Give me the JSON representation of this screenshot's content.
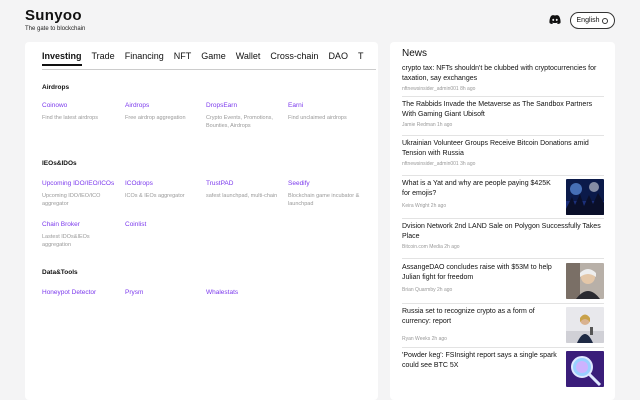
{
  "brand": {
    "name": "Sunyoo",
    "tagline": "The gate to blockchain"
  },
  "header": {
    "language_label": "English"
  },
  "tabs": [
    {
      "label": "Investing",
      "active": true
    },
    {
      "label": "Trade"
    },
    {
      "label": "Financing"
    },
    {
      "label": "NFT"
    },
    {
      "label": "Game"
    },
    {
      "label": "Wallet"
    },
    {
      "label": "Cross-chain"
    },
    {
      "label": "DAO"
    },
    {
      "label": "T"
    }
  ],
  "sections": {
    "airdrops": {
      "title": "Airdrops",
      "items": [
        {
          "name": "Coinowo",
          "desc": "Find the latest airdrops"
        },
        {
          "name": "Airdrops",
          "desc": "Free airdrop aggregation"
        },
        {
          "name": "DropsEarn",
          "desc": "Crypto Events, Promotions, Bounties, Airdrops"
        },
        {
          "name": "Earni",
          "desc": "Find unclaimed airdrops"
        }
      ]
    },
    "ieos": {
      "title": "IEOs&IDOs",
      "items": [
        {
          "name": "Upcoming IDO/IEO/ICOs",
          "desc": "Upcoming IDO/IEO/ICO aggregator"
        },
        {
          "name": "ICOdrops",
          "desc": "ICOs & IEOs aggregator"
        },
        {
          "name": "TrustPAD",
          "desc": "safest launchpad, multi-chain"
        },
        {
          "name": "Seedify",
          "desc": "Blockchain game incubator & launchpad"
        },
        {
          "name": "Chain Broker",
          "desc": "Lastest IDOs&IEOs aggregation"
        },
        {
          "name": "Coinlist",
          "desc": ""
        }
      ]
    },
    "tools": {
      "title": "Data&Tools",
      "items": [
        {
          "name": "Honeypot Detector"
        },
        {
          "name": "Prysm"
        },
        {
          "name": "Whalestats"
        }
      ]
    }
  },
  "news": {
    "title": "News",
    "items": [
      {
        "headline": "crypto tax: NFTs shouldn't be clubbed with cryptocurrencies for taxation, say exchanges",
        "meta": "nftnewsinsider_admin001 8h ago"
      },
      {
        "headline": "The Rabbids Invade the Metaverse as The Sandbox Partners With Gaming Giant Ubisoft",
        "meta": "Jamie Redman 1h ago"
      },
      {
        "headline": "Ukrainian Volunteer Groups Receive Bitcoin Donations amid Tension with Russia",
        "meta": "nftnewsinsider_admin001 3h ago"
      },
      {
        "headline": "What is a Yat and why are people paying $425K for emojis?",
        "meta": "Keira Wright 2h ago",
        "thumb": "crowd-lights"
      },
      {
        "headline": "Dvision Network 2nd LAND Sale on Polygon Successfully Takes Place",
        "meta": "Bitcoin.com Media 2h ago"
      },
      {
        "headline": "AssangeDAO concludes raise with $53M to help Julian fight for freedom",
        "meta": "Brian Quarmby 2h ago",
        "thumb": "portrait"
      },
      {
        "headline": "Russia set to recognize crypto as a form of currency: report",
        "meta": "Ryan Weeks 2h ago",
        "thumb": "speaker"
      },
      {
        "headline": "'Powder keg': FSInsight report says a single spark could see BTC 5X",
        "meta": "",
        "thumb": "magnifier"
      }
    ]
  }
}
